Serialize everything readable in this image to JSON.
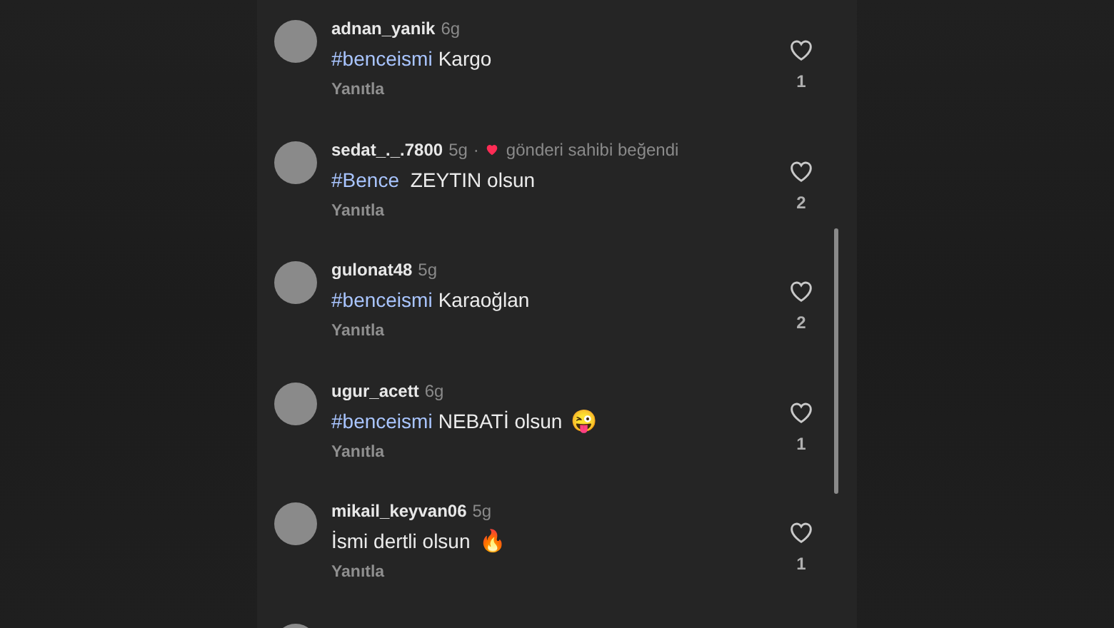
{
  "comments": [
    {
      "username": "adnan_yanik",
      "age": "6g",
      "owner_liked": false,
      "segments": [
        {
          "kind": "hashtag",
          "text": "#benceismi"
        },
        {
          "kind": "text",
          "text": "Kargo"
        }
      ],
      "reply": "Yanıtla",
      "likes": "1"
    },
    {
      "username": "sedat_._.7800",
      "age": "5g",
      "owner_liked": true,
      "separator": "·",
      "owner_note": "gönderi sahibi beğendi",
      "segments": [
        {
          "kind": "hashtag",
          "text": "#Bence"
        },
        {
          "kind": "text",
          "text": " ZEYTIN olsun"
        }
      ],
      "reply": "Yanıtla",
      "likes": "2"
    },
    {
      "username": "gulonat48",
      "age": "5g",
      "owner_liked": false,
      "segments": [
        {
          "kind": "hashtag",
          "text": "#benceismi"
        },
        {
          "kind": "text",
          "text": "Karaoğlan"
        }
      ],
      "reply": "Yanıtla",
      "likes": "2"
    },
    {
      "username": "ugur_acett",
      "age": "6g",
      "owner_liked": false,
      "segments": [
        {
          "kind": "hashtag",
          "text": "#benceismi"
        },
        {
          "kind": "text",
          "text": "NEBATİ olsun"
        },
        {
          "kind": "emoji",
          "text": "😜"
        }
      ],
      "reply": "Yanıtla",
      "likes": "1"
    },
    {
      "username": "mikail_keyvan06",
      "age": "5g",
      "owner_liked": false,
      "segments": [
        {
          "kind": "text",
          "text": "İsmi dertli olsun"
        },
        {
          "kind": "emoji",
          "text": "🔥"
        }
      ],
      "reply": "Yanıtla",
      "likes": "1"
    }
  ]
}
